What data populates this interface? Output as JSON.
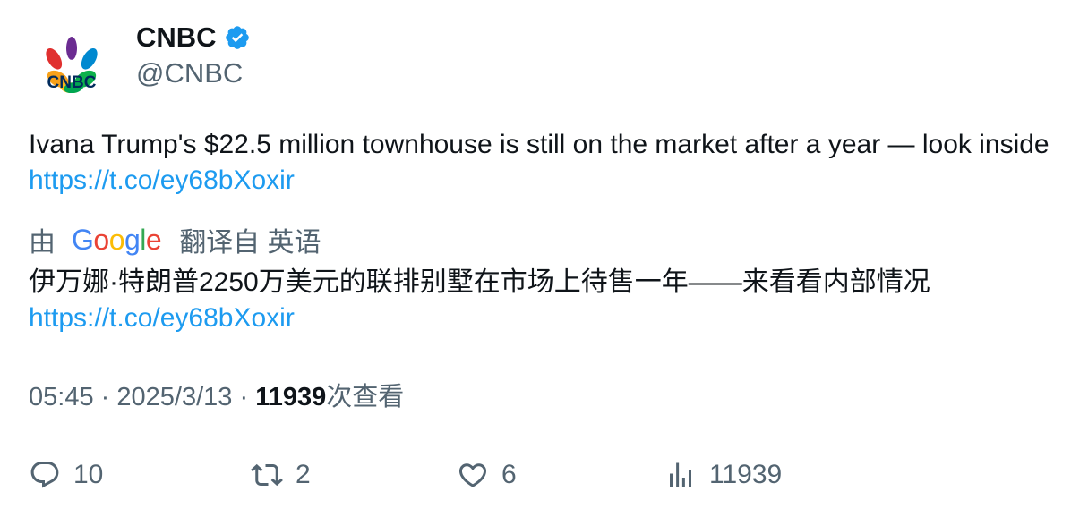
{
  "author": {
    "display_name": "CNBC",
    "handle": "@CNBC",
    "avatar_label": "CNBC",
    "verified": true
  },
  "tweet": {
    "text": "Ivana Trump's $22.5 million townhouse is still on the market after a year — look inside",
    "link": "https://t.co/ey68bXoxir"
  },
  "translation": {
    "prefix": "由",
    "provider": "Google",
    "suffix": "翻译自 英语",
    "text": "伊万娜·特朗普2250万美元的联排别墅在市场上待售一年——来看看内部情况",
    "link": "https://t.co/ey68bXoxir"
  },
  "meta": {
    "time": "05:45",
    "separator": "·",
    "date": "2025/3/13",
    "views_count": "11939",
    "views_label": "次查看"
  },
  "actions": {
    "replies": "10",
    "retweets": "2",
    "likes": "6",
    "views": "11939"
  },
  "colors": {
    "link": "#1d9bf0",
    "verified": "#1d9bf0",
    "secondary_text": "#536471",
    "primary_text": "#0f1419"
  }
}
